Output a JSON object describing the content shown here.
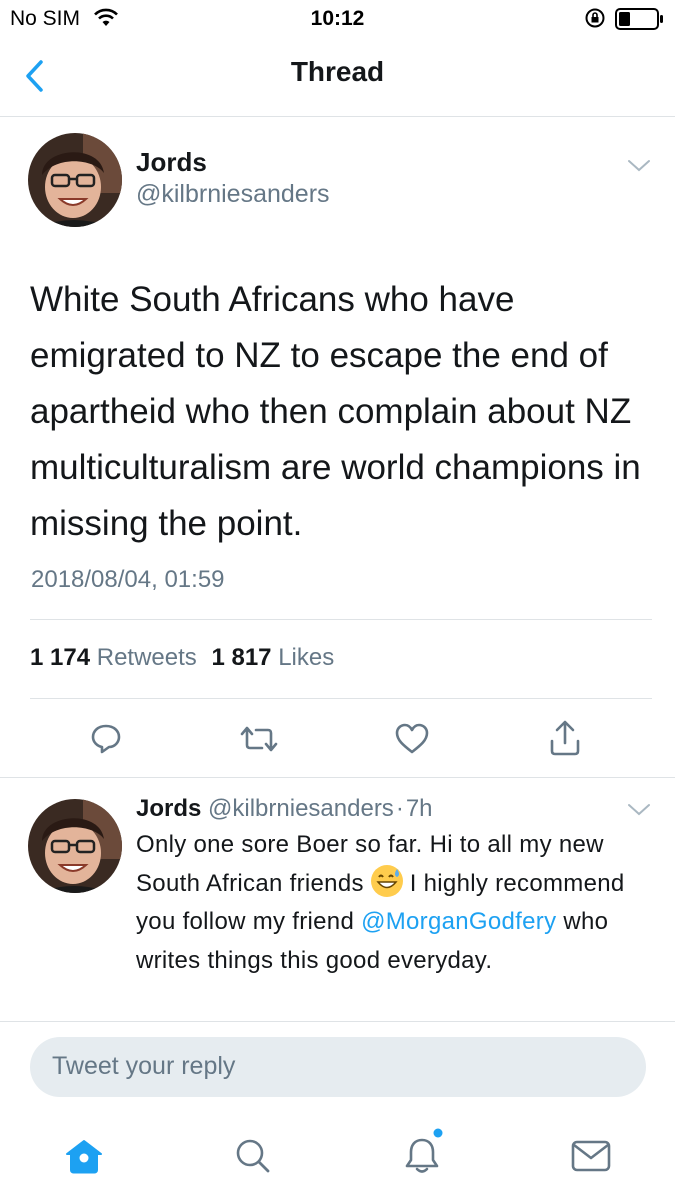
{
  "status_bar": {
    "carrier": "No SIM",
    "time": "10:12"
  },
  "nav": {
    "title": "Thread"
  },
  "tweet": {
    "name": "Jords",
    "handle": "@kilbrniesanders",
    "text": "White South Africans who have emigrated to NZ to escape the end of apartheid who then complain about NZ multiculturalism are world champions in missing the point.",
    "timestamp": "2018/08/04, 01:59",
    "retweets_count": "1 174",
    "retweets_label": "Retweets",
    "likes_count": "1 817",
    "likes_label": "Likes"
  },
  "reply": {
    "name": "Jords",
    "handle": "@kilbrniesanders",
    "separator": "·",
    "age": "7h",
    "text_part1": "Only one sore Boer so far. Hi to all my new South African friends",
    "text_part2": "I highly recommend you follow my friend",
    "mention": "@MorganGodfery",
    "text_part3": "who writes things this good everyday."
  },
  "composer": {
    "placeholder": "Tweet your reply"
  },
  "icons": {
    "back": "chevron-left-icon",
    "wifi": "wifi-icon",
    "orientation_lock": "orientation-lock-icon",
    "battery": "battery-icon",
    "caret": "chevron-down-icon",
    "reply": "reply-icon",
    "retweet": "retweet-icon",
    "like": "heart-icon",
    "share": "share-icon",
    "emoji": "grinning-sweat-emoji",
    "tab_home": "home-icon",
    "tab_search": "search-icon",
    "tab_notifications": "bell-icon",
    "tab_messages": "mail-icon"
  },
  "colors": {
    "accent": "#1da1f2",
    "secondary_text": "#657786",
    "divider": "#dfe3e6",
    "composer_bg": "#e6ecf0"
  }
}
